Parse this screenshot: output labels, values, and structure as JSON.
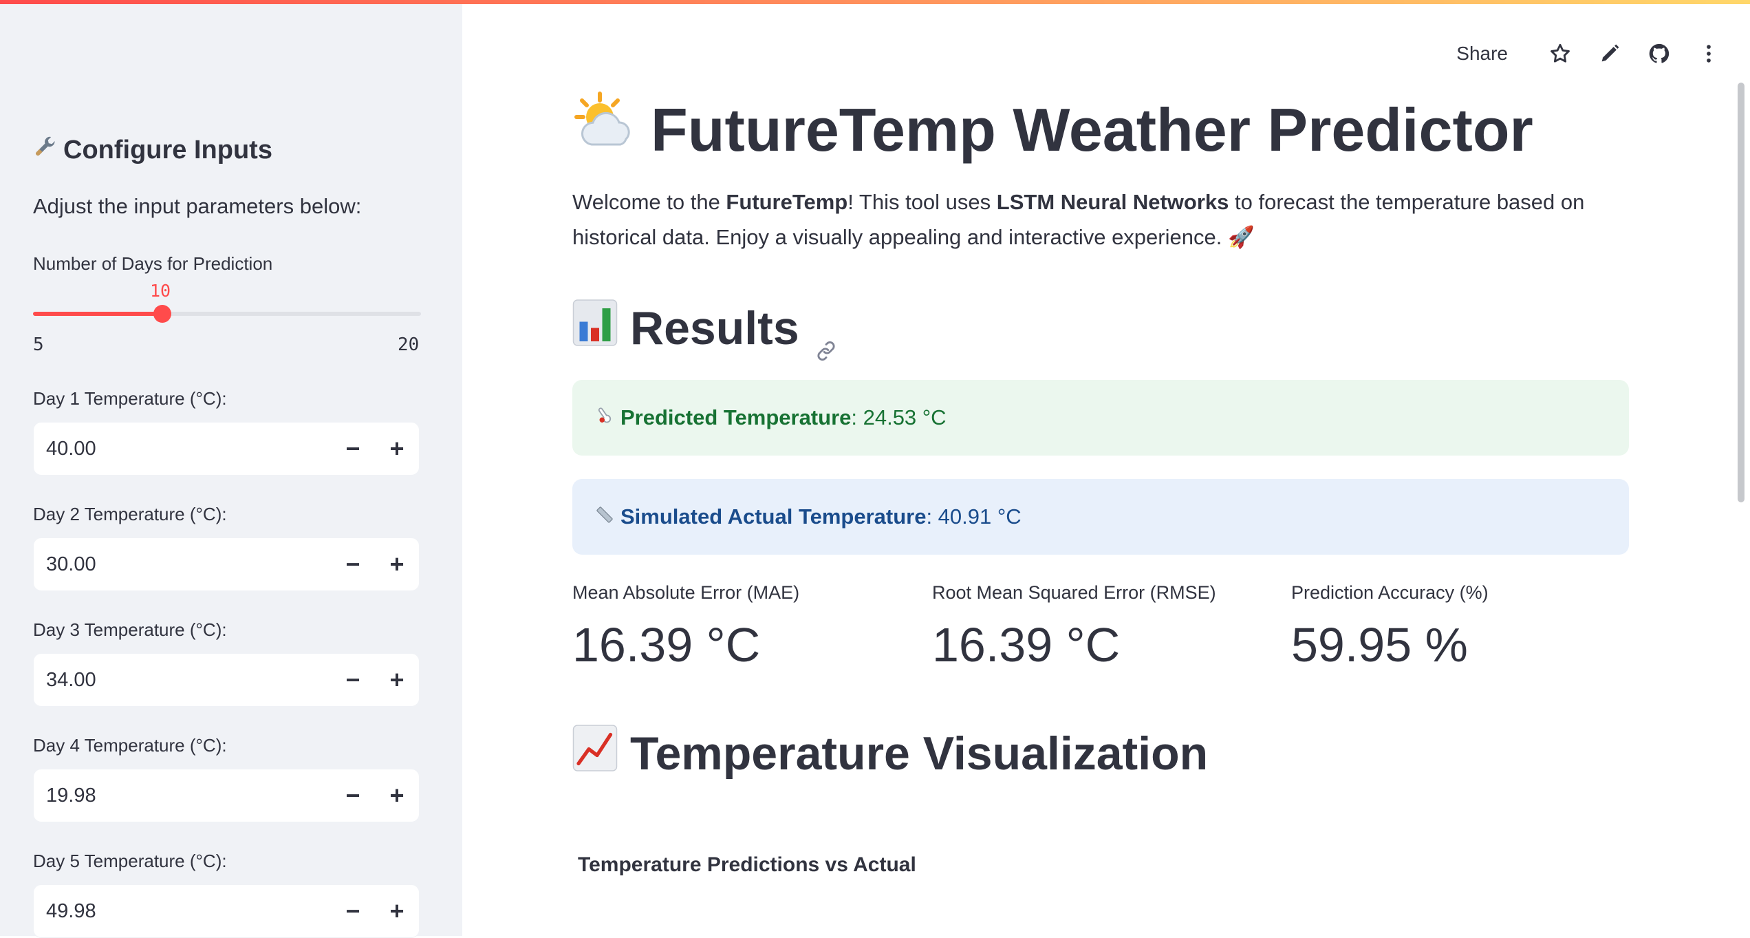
{
  "app": {
    "toolbar": {
      "share_label": "Share",
      "icons": [
        "star-icon",
        "pencil-icon",
        "github-icon",
        "more-vertical-icon"
      ]
    },
    "accent_color": "#ff4b4b"
  },
  "sidebar": {
    "title": "Configure Inputs",
    "title_icon": "wrench-icon",
    "subtitle": "Adjust the input parameters below:",
    "slider": {
      "label": "Number of Days for Prediction",
      "value": "10",
      "min": "5",
      "max": "20"
    },
    "fields": [
      {
        "label": "Day 1 Temperature (°C):",
        "value": "40.00"
      },
      {
        "label": "Day 2 Temperature (°C):",
        "value": "30.00"
      },
      {
        "label": "Day 3 Temperature (°C):",
        "value": "34.00"
      },
      {
        "label": "Day 4 Temperature (°C):",
        "value": "19.98"
      },
      {
        "label": "Day 5 Temperature (°C):",
        "value": "49.98"
      }
    ],
    "minus": "−",
    "plus": "+"
  },
  "main": {
    "title": "FutureTemp Weather Predictor",
    "title_icon": "sun-behind-cloud-icon",
    "intro": {
      "p1": "Welcome to the ",
      "b1": "FutureTemp",
      "p2": "! This tool uses ",
      "b2": "LSTM Neural Networks",
      "p3": " to forecast the temperature based on historical data. Enjoy a visually appealing and interactive experience. ",
      "emoji": "🚀"
    },
    "results": {
      "heading": "Results",
      "heading_icon": "bar-chart-icon",
      "predicted_label": "Predicted Temperature",
      "predicted_value": ": 24.53 °C",
      "actual_label": "Simulated Actual Temperature",
      "actual_value": ": 40.91 °C",
      "metrics": [
        {
          "label": "Mean Absolute Error (MAE)",
          "value": "16.39 °C"
        },
        {
          "label": "Root Mean Squared Error (RMSE)",
          "value": "16.39 °C"
        },
        {
          "label": "Prediction Accuracy (%)",
          "value": "59.95 %"
        }
      ]
    },
    "visualization": {
      "heading": "Temperature Visualization",
      "heading_icon": "chart-increasing-icon",
      "chart_title": "Temperature Predictions vs Actual"
    }
  }
}
